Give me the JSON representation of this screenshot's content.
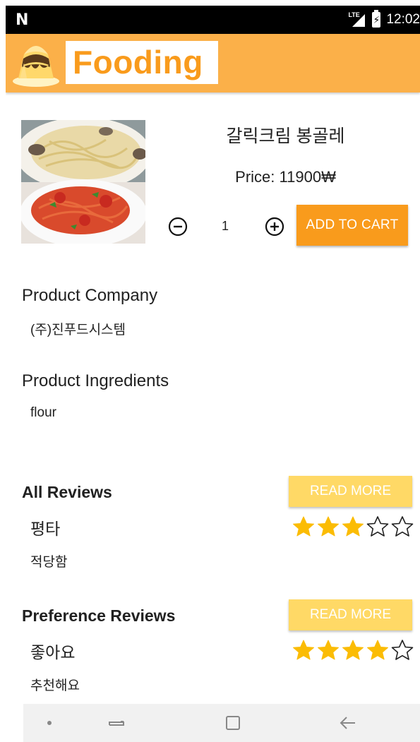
{
  "status_bar": {
    "notification_icon": "N",
    "network_label": "LTE",
    "time": "12:02"
  },
  "app_bar": {
    "logo_icon": "pudding-icon",
    "logo_text": "Fooding",
    "color": "#fbb049"
  },
  "product": {
    "name": "갈릭크림 봉골레",
    "price": "Price: 11900₩",
    "quantity": "1",
    "add_to_cart_label": "ADD TO CART",
    "accent_color": "#f99b1c"
  },
  "details": {
    "company_title": "Product Company",
    "company_value": "(주)진푸드시스템",
    "ingredients_title": "Product Ingredients",
    "ingredients_value": "flour"
  },
  "all_reviews": {
    "header": "All Reviews",
    "read_more_label": "READ MORE",
    "review": {
      "title": "평타",
      "body": "적당함",
      "rating": 3,
      "max_rating": 5
    }
  },
  "preference_reviews": {
    "header": "Preference Reviews",
    "read_more_label": "READ MORE",
    "review": {
      "title": "좋아요",
      "body": "추천해요",
      "rating": 4,
      "max_rating": 5
    }
  },
  "nav_bar": {
    "items": [
      "dot-icon",
      "recent-apps-icon",
      "home-icon",
      "back-icon"
    ]
  }
}
